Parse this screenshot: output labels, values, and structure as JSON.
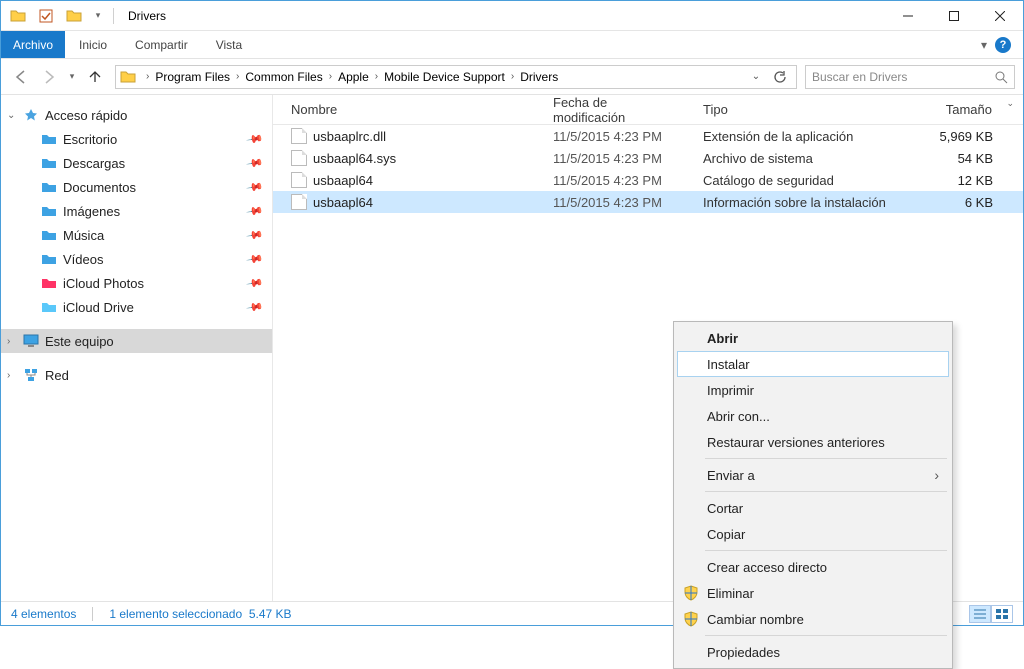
{
  "window": {
    "title": "Drivers"
  },
  "ribbon": {
    "file": "Archivo",
    "tabs": [
      "Inicio",
      "Compartir",
      "Vista"
    ]
  },
  "breadcrumb": [
    "Program Files",
    "Common Files",
    "Apple",
    "Mobile Device Support",
    "Drivers"
  ],
  "search": {
    "placeholder": "Buscar en Drivers"
  },
  "sidebar": {
    "quick_access": "Acceso rápido",
    "items": [
      {
        "label": "Escritorio",
        "pinned": true
      },
      {
        "label": "Descargas",
        "pinned": true
      },
      {
        "label": "Documentos",
        "pinned": true
      },
      {
        "label": "Imágenes",
        "pinned": true
      },
      {
        "label": "Música",
        "pinned": true
      },
      {
        "label": "Vídeos",
        "pinned": true
      },
      {
        "label": "iCloud Photos",
        "pinned": true
      },
      {
        "label": "iCloud Drive",
        "pinned": true
      }
    ],
    "this_pc": "Este equipo",
    "network": "Red"
  },
  "columns": {
    "name": "Nombre",
    "date": "Fecha de modificación",
    "type": "Tipo",
    "size": "Tamaño"
  },
  "files": [
    {
      "name": "usbaaplrc.dll",
      "date": "11/5/2015 4:23 PM",
      "type": "Extensión de la aplicación",
      "size": "5,969 KB",
      "selected": false
    },
    {
      "name": "usbaapl64.sys",
      "date": "11/5/2015 4:23 PM",
      "type": "Archivo de sistema",
      "size": "54 KB",
      "selected": false
    },
    {
      "name": "usbaapl64",
      "date": "11/5/2015 4:23 PM",
      "type": "Catálogo de seguridad",
      "size": "12 KB",
      "selected": false
    },
    {
      "name": "usbaapl64",
      "date": "11/5/2015 4:23 PM",
      "type": "Información sobre la instalación",
      "size": "6 KB",
      "selected": true
    }
  ],
  "contextmenu": {
    "items": [
      {
        "label": "Abrir",
        "bold": true
      },
      {
        "label": "Instalar",
        "hover": true
      },
      {
        "label": "Imprimir"
      },
      {
        "label": "Abrir con..."
      },
      {
        "label": "Restaurar versiones anteriores"
      },
      {
        "sep": true
      },
      {
        "label": "Enviar a",
        "submenu": true
      },
      {
        "sep": true
      },
      {
        "label": "Cortar"
      },
      {
        "label": "Copiar"
      },
      {
        "sep": true
      },
      {
        "label": "Crear acceso directo"
      },
      {
        "label": "Eliminar",
        "shield": true
      },
      {
        "label": "Cambiar nombre",
        "shield": true
      },
      {
        "sep": true
      },
      {
        "label": "Propiedades"
      }
    ]
  },
  "status": {
    "count": "4 elementos",
    "selection": "1 elemento seleccionado",
    "size": "5.47 KB"
  }
}
